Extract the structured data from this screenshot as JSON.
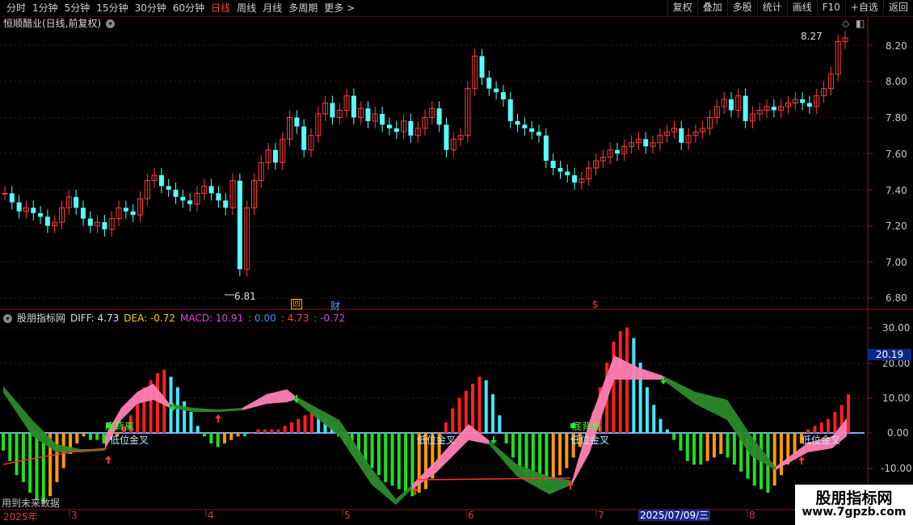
{
  "toolbar": {
    "periods": [
      "分时",
      "1分钟",
      "5分钟",
      "15分钟",
      "30分钟",
      "60分钟",
      "日线",
      "周线",
      "月线",
      "多周期",
      "更多"
    ],
    "active_period": "日线",
    "right_buttons": [
      "复权",
      "叠加",
      "多股",
      "统计",
      "画线",
      "F10",
      "+自选",
      "返回"
    ]
  },
  "stock": {
    "title": "恒顺醋业(日线,前复权)"
  },
  "price_axis": [
    "8.20",
    "8.00",
    "7.80",
    "7.60",
    "7.40",
    "7.20",
    "7.00",
    "6.80"
  ],
  "price_high_label": "8.27",
  "price_low_label": "6.81",
  "markers": {
    "hui": "回",
    "cai": "财",
    "dollar": "$"
  },
  "indicator": {
    "name": "股朋指标网",
    "diff": "DIFF: 4.73",
    "dea": "DEA: -0.72",
    "macd": "MACD: 10.91",
    "v1": ": 0.00",
    "v2": ": 4.73",
    "v3": ": -0.72",
    "axis": [
      "30.00",
      "20.00",
      "10.00",
      "0.00",
      "-10.00"
    ],
    "current_value": "20.19",
    "labels": {
      "low_gold": "低位金叉",
      "bottom": "底背离",
      "future": "用到未来数据"
    }
  },
  "x_axis": {
    "labels": [
      "2025年",
      "3",
      "4",
      "5",
      "6",
      "7",
      "8"
    ],
    "cursor_date": "2025/07/09/三"
  },
  "watermark": {
    "title": "股朋指标网",
    "url": "www.7gpzb.com"
  },
  "colors": {
    "up": "#ff3c3c",
    "down": "#54ffff",
    "green_band": "#2b8a2b",
    "pink_band": "#ff7fb4"
  }
}
